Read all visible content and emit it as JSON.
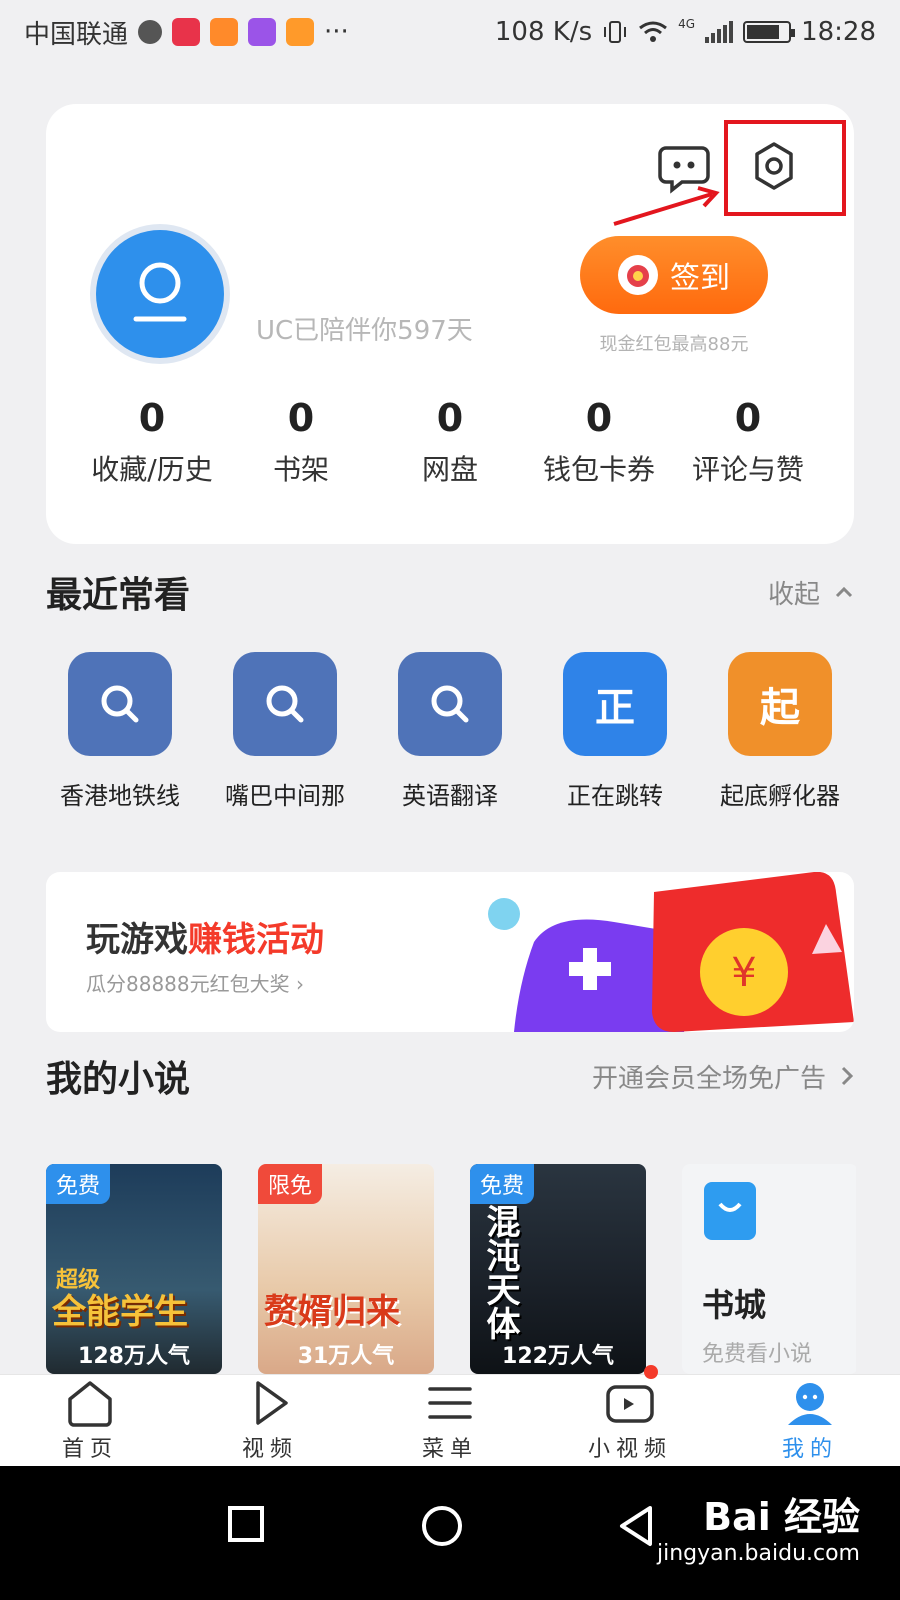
{
  "status_bar": {
    "carrier": "中国联通",
    "speed": "108 K/s",
    "network": "4G",
    "time": "18:28",
    "more": "···"
  },
  "profile": {
    "days_text": "UC已陪伴你597天",
    "checkin_label": "签到",
    "checkin_sub": "现金红包最高88元",
    "stats": [
      {
        "num": "0",
        "label": "收藏/历史"
      },
      {
        "num": "0",
        "label": "书架"
      },
      {
        "num": "0",
        "label": "网盘"
      },
      {
        "num": "0",
        "label": "钱包卡券"
      },
      {
        "num": "0",
        "label": "评论与赞"
      }
    ]
  },
  "recent": {
    "title": "最近常看",
    "collapse": "收起",
    "items": [
      {
        "label": "香港地铁线",
        "glyph": "",
        "color": "#4f73b8"
      },
      {
        "label": "嘴巴中间那",
        "glyph": "",
        "color": "#4f73b8"
      },
      {
        "label": "英语翻译",
        "glyph": "",
        "color": "#4f73b8"
      },
      {
        "label": "正在跳转",
        "glyph": "正",
        "color": "#2f83e8"
      },
      {
        "label": "起底孵化器",
        "glyph": "起",
        "color": "#f0902a"
      }
    ]
  },
  "banner": {
    "title_main": "玩游戏",
    "title_hot": "赚钱活动",
    "subtitle": "瓜分88888元红包大奖 ›"
  },
  "novels": {
    "title": "我的小说",
    "promo": "开通会员全场免广告",
    "items": [
      {
        "tag": "免费",
        "art_title": "全能学生",
        "art_top": "超级",
        "popularity": "128万人气",
        "tag_color": "#2e90ec"
      },
      {
        "tag": "限免",
        "art_title": "赘婿归来",
        "art_top": "",
        "popularity": "31万人气",
        "tag_color": "#f04a3a"
      },
      {
        "tag": "免费",
        "art_title": "混沌天体",
        "art_top": "",
        "popularity": "122万人气",
        "tag_color": "#2e90ec"
      }
    ],
    "bookstore": {
      "title": "书城",
      "sub": "免费看小说"
    }
  },
  "bottom_nav": [
    {
      "label": "首页",
      "icon": "home-icon"
    },
    {
      "label": "视频",
      "icon": "play-icon"
    },
    {
      "label": "菜单",
      "icon": "menu-icon"
    },
    {
      "label": "小视频",
      "icon": "camera-icon"
    },
    {
      "label": "我的",
      "icon": "person-icon"
    }
  ],
  "watermark": {
    "main": "Bai 经验",
    "sub": "jingyan.baidu.com"
  },
  "colors": {
    "accent": "#2e90ec",
    "checkin": "#ff7a1a",
    "highlight": "#e3161e"
  }
}
